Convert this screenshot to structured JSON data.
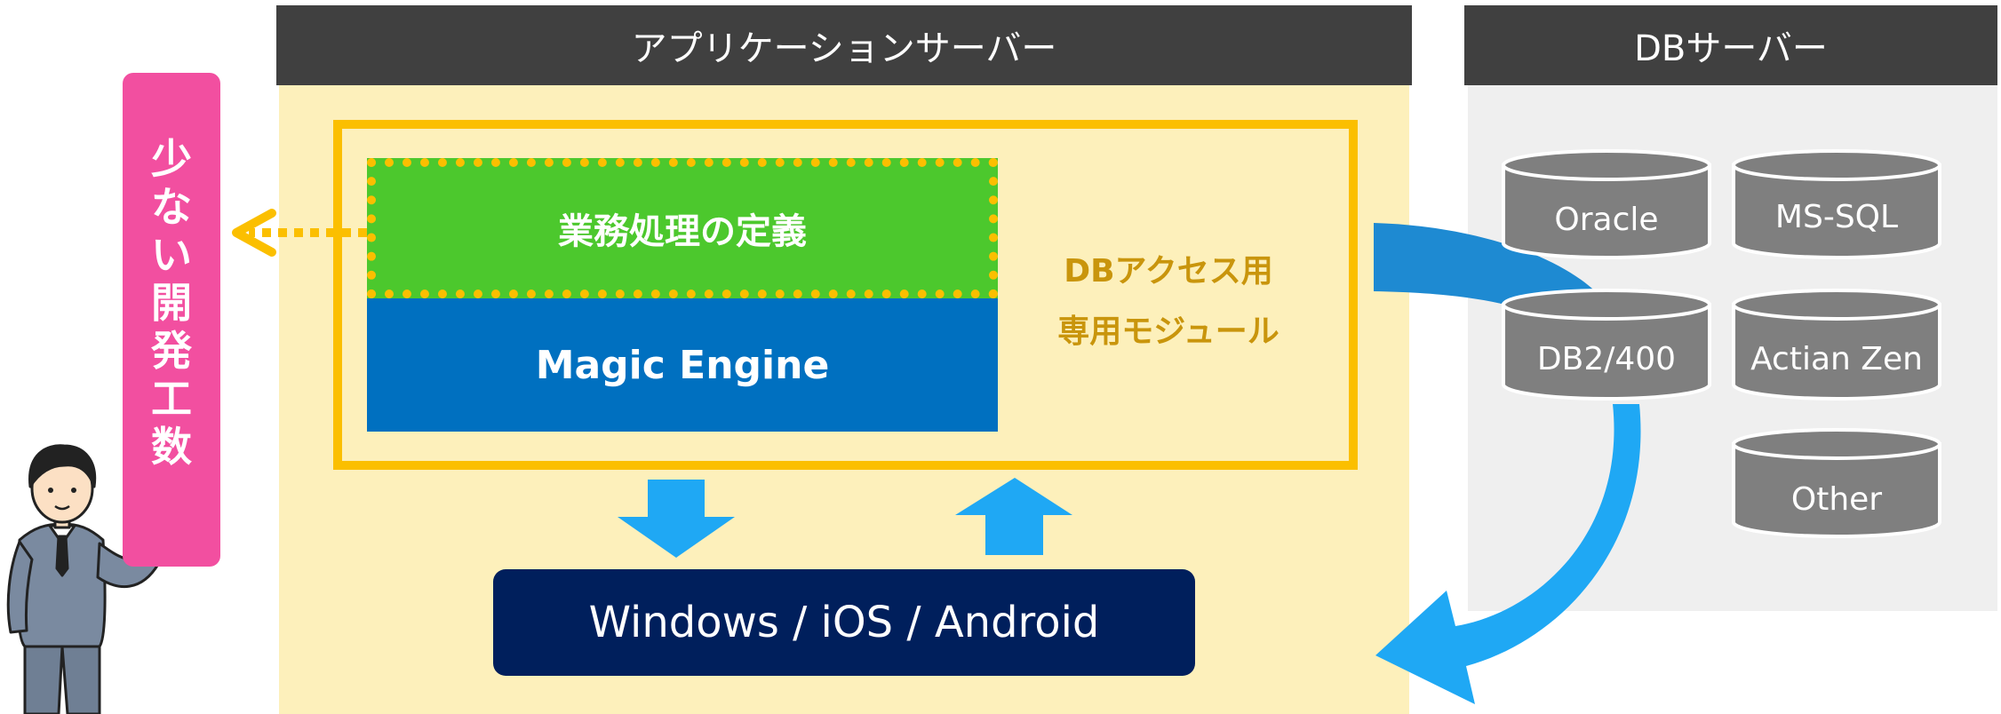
{
  "app_server": {
    "title": "アプリケーションサーバー",
    "business_logic_label": "業務処理の定義",
    "engine_label": "Magic Engine",
    "db_module_label_1": "DBアクセス用",
    "db_module_label_2": "専用モジュール",
    "platform_label": "Windows / iOS / Android"
  },
  "db_server": {
    "title": "DBサーバー",
    "databases": [
      "Oracle",
      "MS-SQL",
      "DB2/400",
      "Actian Zen",
      "Other"
    ]
  },
  "callout": {
    "chars": [
      "少",
      "な",
      "い",
      "開",
      "発",
      "工",
      "数"
    ]
  },
  "colors": {
    "header_bg": "#404040",
    "app_panel": "#fdf0bb",
    "db_panel": "#efefef",
    "module_frame": "#fbbf00",
    "business_logic": "#4cc82d",
    "engine": "#0070c0",
    "platform": "#001f5c",
    "arrow": "#1fa8f4",
    "callout": "#f24fa0",
    "cylinder": "#7f7f7f"
  }
}
